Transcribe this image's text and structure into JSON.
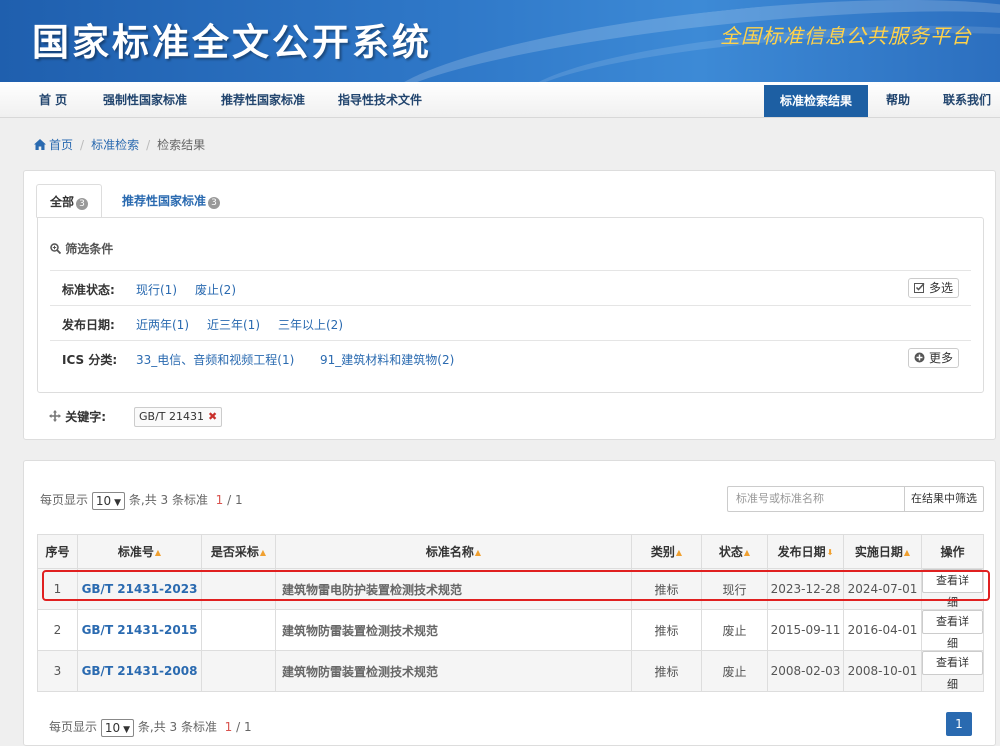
{
  "banner": {
    "title": "国家标准全文公开系统",
    "subtitle": "全国标准信息公共服务平台"
  },
  "nav": {
    "items": [
      "首 页",
      "强制性国家标准",
      "推荐性国家标准",
      "指导性技术文件"
    ],
    "active": "标准检索结果",
    "right": [
      "帮助",
      "联系我们"
    ]
  },
  "breadcrumb": [
    "首页",
    "标准检索",
    "检索结果"
  ],
  "tabs": [
    {
      "label": "全部",
      "count": "3"
    },
    {
      "label": "推荐性国家标准",
      "count": "3"
    }
  ],
  "filters": {
    "title": "筛选条件",
    "rows": [
      {
        "label": "标准状态:",
        "options": [
          "现行(1)",
          "废止(2)"
        ],
        "button": "多选"
      },
      {
        "label": "发布日期:",
        "options": [
          "近两年(1)",
          "近三年(1)",
          "三年以上(2)"
        ]
      },
      {
        "label": "ICS 分类:",
        "options": [
          "33_电信、音频和视频工程(1)",
          "91_建筑材料和建筑物(2)"
        ],
        "button": "更多"
      }
    ],
    "keyword_label": "关键字:",
    "keyword": "GB/T 21431"
  },
  "pager": {
    "prefix": "每页显示",
    "per_page": "10",
    "mid": "条,共",
    "total": "3",
    "suffix": "条标准",
    "current": "1",
    "slash": "/",
    "pages": "1",
    "page_button": "1"
  },
  "search": {
    "placeholder": "标准号或标准名称",
    "button": "在结果中筛选"
  },
  "table": {
    "headers": [
      "序号",
      "标准号",
      "是否采标",
      "标准名称",
      "类别",
      "状态",
      "发布日期",
      "实施日期",
      "操作"
    ],
    "rows": [
      {
        "idx": "1",
        "code": "GB/T 21431-2023",
        "adopted": "",
        "name": "建筑物雷电防护装置检测技术规范",
        "type": "推标",
        "status": "现行",
        "pub": "2023-12-28",
        "impl": "2024-07-01",
        "action": "查看详细"
      },
      {
        "idx": "2",
        "code": "GB/T 21431-2015",
        "adopted": "",
        "name": "建筑物防雷装置检测技术规范",
        "type": "推标",
        "status": "废止",
        "pub": "2015-09-11",
        "impl": "2016-04-01",
        "action": "查看详细"
      },
      {
        "idx": "3",
        "code": "GB/T 21431-2008",
        "adopted": "",
        "name": "建筑物防雷装置检测技术规范",
        "type": "推标",
        "status": "废止",
        "pub": "2008-02-03",
        "impl": "2008-10-01",
        "action": "查看详细"
      }
    ]
  },
  "colors": {
    "brand_blue": "#1d5fa3",
    "link_blue": "#2a6ab0",
    "status_current": "#3a9a3a",
    "status_obsolete": "#d9534f",
    "highlight_red": "#e02020"
  }
}
